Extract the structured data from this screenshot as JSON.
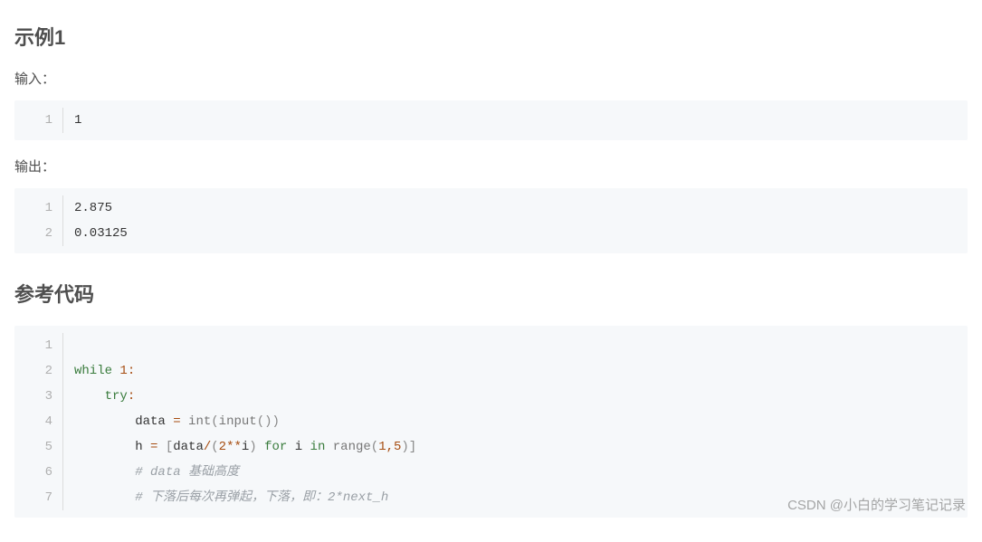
{
  "headings": {
    "example": "示例1",
    "reference": "参考代码"
  },
  "labels": {
    "input": "输入：",
    "output": "输出："
  },
  "input_block": {
    "lines": [
      "1"
    ]
  },
  "output_block": {
    "lines": [
      "2.875",
      "0.03125"
    ]
  },
  "ref_code": {
    "lines": [
      "",
      "while 1:",
      "    try:",
      "        data = int(input())",
      "        h = [data/(2**i) for i in range(1,5)]",
      "        # data 基础高度",
      "        # 下落后每次再弹起，下落，即：2*next_h"
    ]
  },
  "watermark": "CSDN @小白的学习笔记记录"
}
